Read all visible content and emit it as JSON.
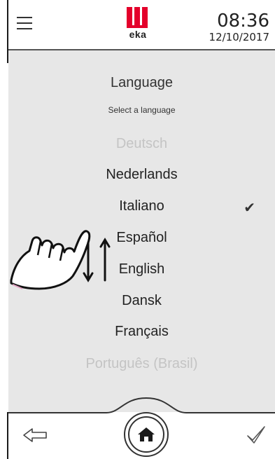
{
  "header": {
    "brand": "eka",
    "time": "08:36",
    "date": "12/10/2017"
  },
  "screen": {
    "title": "Language",
    "subtitle": "Select a language"
  },
  "languages": [
    {
      "label": "Deutsch",
      "state": "faded"
    },
    {
      "label": "Nederlands",
      "state": "normal"
    },
    {
      "label": "Italiano",
      "state": "selected"
    },
    {
      "label": "Español",
      "state": "normal"
    },
    {
      "label": "English",
      "state": "normal"
    },
    {
      "label": "Dansk",
      "state": "normal"
    },
    {
      "label": "Français",
      "state": "normal"
    },
    {
      "label": "Português (Brasil)",
      "state": "faded"
    }
  ],
  "icons": {
    "menu": "hamburger-icon",
    "check": "checkmark-icon",
    "back": "left-arrow-icon",
    "home": "home-icon",
    "confirm": "check-outline-icon",
    "gesture": "hand-swipe-icon"
  },
  "colors": {
    "brand_red": "#e4002b",
    "content_bg": "#e7e7e7",
    "faded_text": "#c4c4c4"
  }
}
